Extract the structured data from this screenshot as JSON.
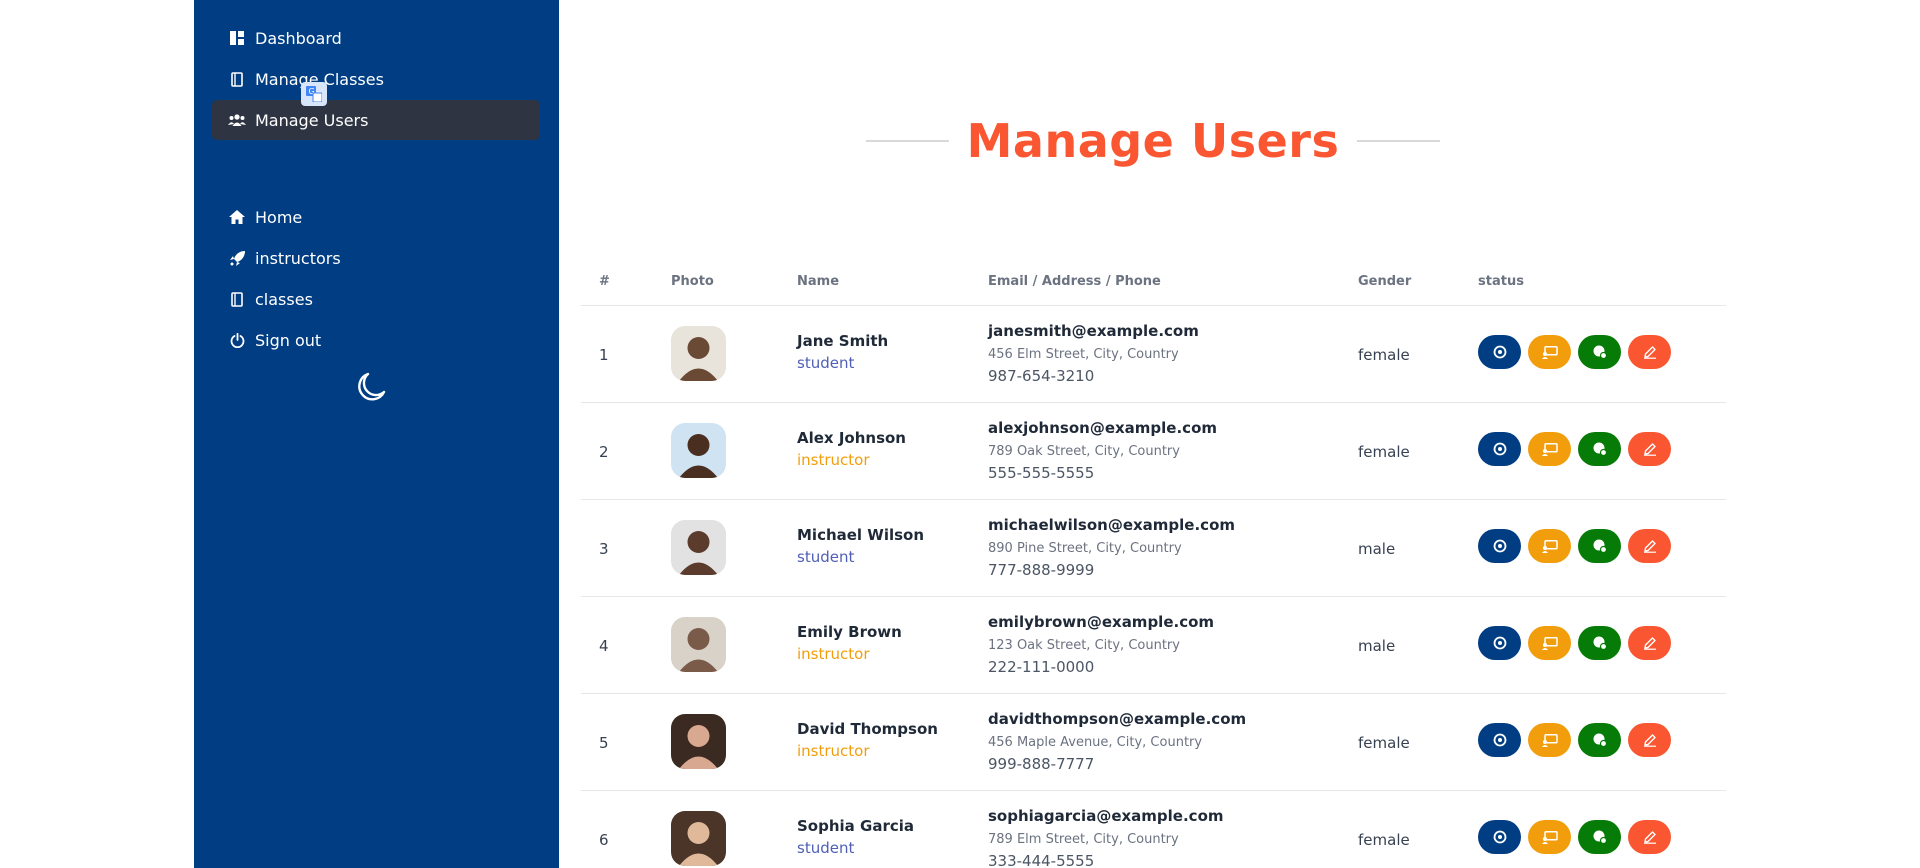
{
  "sidebar": {
    "top_items": [
      {
        "label": "Dashboard",
        "icon": "dashboard-icon"
      },
      {
        "label": "Manage Classes",
        "icon": "book-icon"
      },
      {
        "label": "Manage Users",
        "icon": "users-icon",
        "active": true
      }
    ],
    "bottom_items": [
      {
        "label": "Home",
        "icon": "home-icon"
      },
      {
        "label": "instructors",
        "icon": "rocket-icon"
      },
      {
        "label": "classes",
        "icon": "book-icon"
      },
      {
        "label": "Sign out",
        "icon": "power-icon"
      }
    ],
    "theme_toggle_icon": "moon-icon"
  },
  "main": {
    "title": "Manage Users"
  },
  "table": {
    "headers": [
      "#",
      "Photo",
      "Name",
      "Email / Address / Phone",
      "Gender",
      "status"
    ],
    "rows": [
      {
        "num": "1",
        "name": "Jane Smith",
        "role": "student",
        "email": "janesmith@example.com",
        "address": "456 Elm Street, City, Country",
        "phone": "987-654-3210",
        "gender": "female"
      },
      {
        "num": "2",
        "name": "Alex Johnson",
        "role": "instructor",
        "email": "alexjohnson@example.com",
        "address": "789 Oak Street, City, Country",
        "phone": "555-555-5555",
        "gender": "female"
      },
      {
        "num": "3",
        "name": "Michael Wilson",
        "role": "student",
        "email": "michaelwilson@example.com",
        "address": "890 Pine Street, City, Country",
        "phone": "777-888-9999",
        "gender": "male"
      },
      {
        "num": "4",
        "name": "Emily Brown",
        "role": "instructor",
        "email": "emilybrown@example.com",
        "address": "123 Oak Street, City, Country",
        "phone": "222-111-0000",
        "gender": "male"
      },
      {
        "num": "5",
        "name": "David Thompson",
        "role": "instructor",
        "email": "davidthompson@example.com",
        "address": "456 Maple Avenue, City, Country",
        "phone": "999-888-7777",
        "gender": "female"
      },
      {
        "num": "6",
        "name": "Sophia Garcia",
        "role": "student",
        "email": "sophiagarcia@example.com",
        "address": "789 Elm Street, City, Country",
        "phone": "333-444-5555",
        "gender": "female"
      }
    ],
    "action_buttons": [
      {
        "icon": "admin-icon",
        "color": "#003d82"
      },
      {
        "icon": "instructor-icon",
        "color": "#f29e0c"
      },
      {
        "icon": "student-icon",
        "color": "#077b07"
      },
      {
        "icon": "edit-icon",
        "color": "#fa5631"
      }
    ]
  },
  "colors": {
    "sidebar_bg": "#003d82",
    "active_item_bg": "#2e3441",
    "title_accent": "#fa5631",
    "student_role": "#4f5fb5",
    "instructor_role": "#f29e0c"
  }
}
